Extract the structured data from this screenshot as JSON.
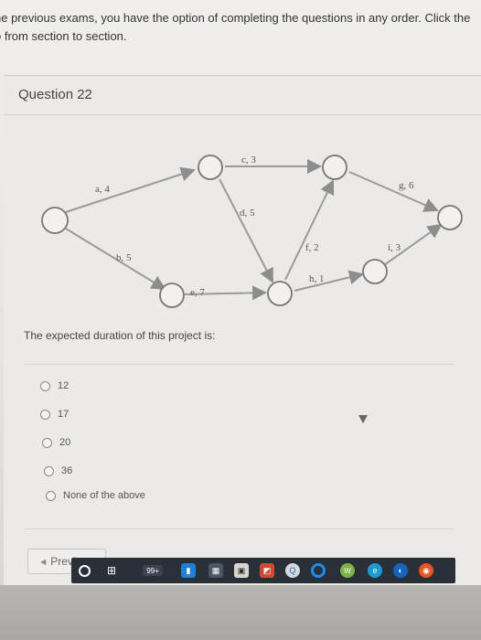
{
  "intro": {
    "line1": "he previous exams, you have the option of completing the questions in any order. Click the",
    "line2": "o from section to section."
  },
  "question": {
    "title": "Question 22",
    "prompt": "The expected duration of this project is:"
  },
  "network": {
    "edges": [
      {
        "label": "a, 4"
      },
      {
        "label": "b, 5"
      },
      {
        "label": "c, 3"
      },
      {
        "label": "d, 5"
      },
      {
        "label": "e, 7"
      },
      {
        "label": "f, 2"
      },
      {
        "label": "g, 6"
      },
      {
        "label": "h, 1"
      },
      {
        "label": "i, 3"
      }
    ]
  },
  "options": [
    {
      "label": "12"
    },
    {
      "label": "17"
    },
    {
      "label": "20"
    },
    {
      "label": "36"
    },
    {
      "label": "None of the above"
    }
  ],
  "nav": {
    "previous_label": "Previous"
  },
  "taskbar": {
    "badge": "99+"
  },
  "colors": {
    "page": "#ebeae7",
    "edge": "#9a9a9a",
    "node": "#777777",
    "taskbar": "#2a3038"
  }
}
